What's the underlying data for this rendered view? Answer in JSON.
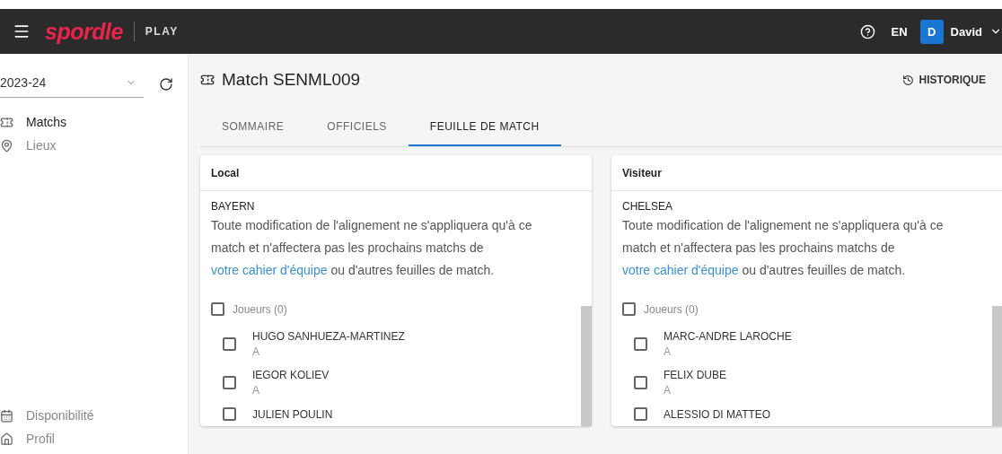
{
  "topbar": {
    "logo": "spordle",
    "product": "PLAY",
    "language": "EN",
    "user": {
      "initial": "D",
      "name": "David"
    }
  },
  "sidebar": {
    "season": "2023-24",
    "items": [
      {
        "label": "Matchs",
        "selected": true
      },
      {
        "label": "Lieux",
        "selected": false
      }
    ],
    "bottom_items": [
      {
        "label": "Disponibilité"
      },
      {
        "label": "Profil"
      }
    ]
  },
  "page": {
    "title": "Match SENML009",
    "history": "HISTORIQUE",
    "tabs": [
      {
        "label": "SOMMAIRE",
        "selected": false
      },
      {
        "label": "OFFICIELS",
        "selected": false
      },
      {
        "label": "FEUILLE DE MATCH",
        "selected": true
      }
    ],
    "teams": [
      {
        "side": "Local",
        "team": "BAYERN",
        "note_before": "Toute modification de l'alignement ne s'appliquera qu'à ce match et n'affectera pas les prochains matchs de ",
        "note_link": "votre cahier d'équipe",
        "note_after": " ou d'autres feuilles de match.",
        "players_label": "Joueurs (0)",
        "all_checked": false,
        "players": [
          {
            "name": "HUGO SANHUEZA-MARTINEZ",
            "position": "A",
            "checked": false
          },
          {
            "name": "IEGOR KOLIEV",
            "position": "A",
            "checked": false
          },
          {
            "name": "JULIEN POULIN",
            "checked": false
          }
        ]
      },
      {
        "side": "Visiteur",
        "team": "CHELSEA",
        "note_before": "Toute modification de l'alignement ne s'appliquera qu'à ce match et n'affectera pas les prochains matchs de ",
        "note_link": "votre cahier d'équipe",
        "note_after": " ou d'autres feuilles de match.",
        "players_label": "Joueurs (0)",
        "all_checked": false,
        "players": [
          {
            "name": "MARC-ANDRE LAROCHE",
            "position": "A",
            "checked": false
          },
          {
            "name": "FELIX DUBE",
            "position": "A",
            "checked": false
          },
          {
            "name": "ALESSIO DI MATTEO",
            "checked": false
          }
        ]
      }
    ]
  }
}
